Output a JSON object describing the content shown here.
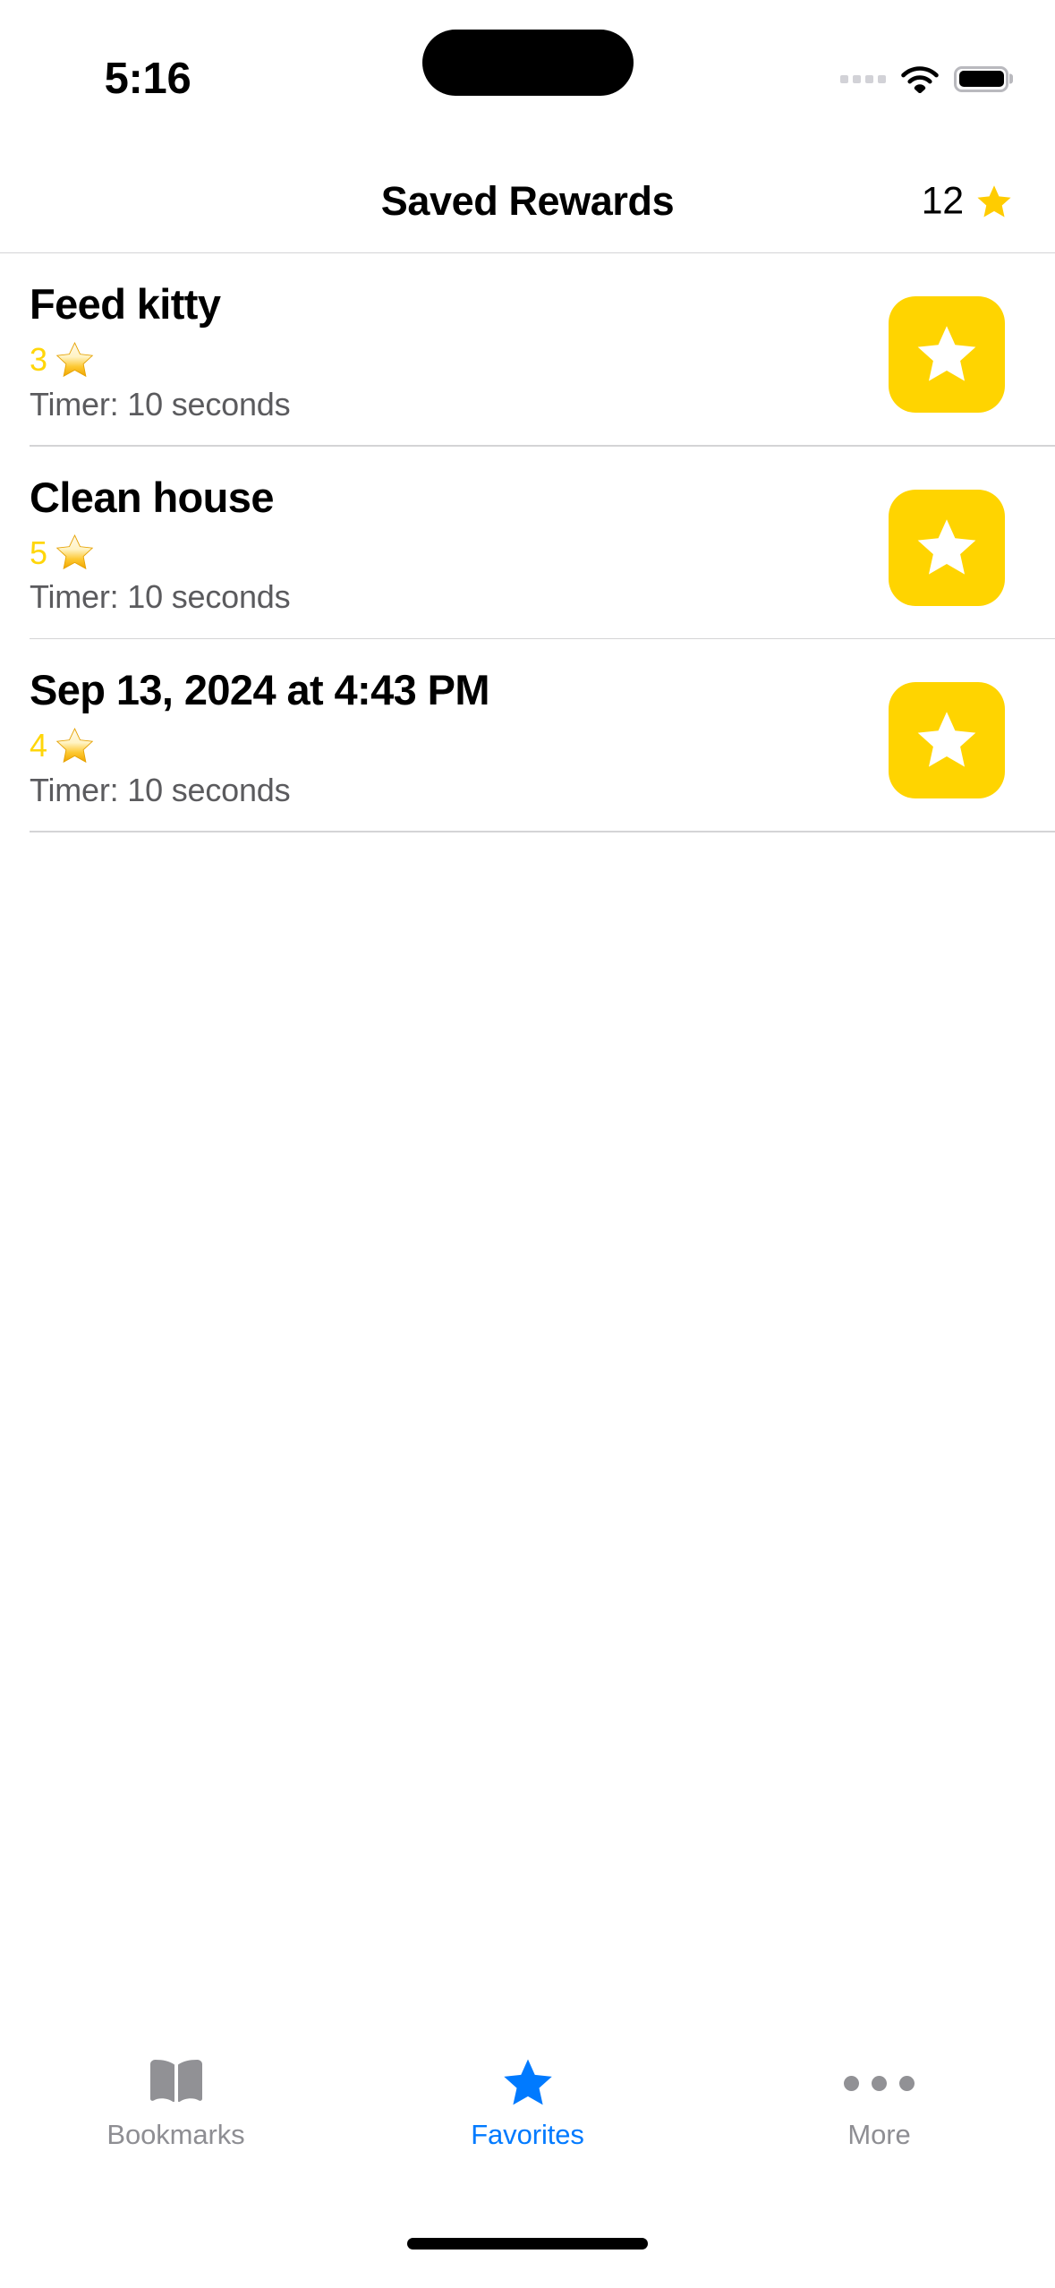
{
  "status_bar": {
    "time": "5:16",
    "cellular_icon": "cellular-dots-icon",
    "wifi_icon": "wifi-icon",
    "battery_icon": "battery-icon"
  },
  "header": {
    "title": "Saved Rewards",
    "points_value": "12",
    "points_star_icon": "star-filled-icon",
    "accent_gold": "#FFCC00"
  },
  "rewards": [
    {
      "title": "Feed kitty",
      "points": "3",
      "star_icon": "star-emoji-icon",
      "timer": "Timer: 10 seconds",
      "action_icon": "star-button-icon"
    },
    {
      "title": "Clean house",
      "points": "5",
      "star_icon": "star-emoji-icon",
      "timer": "Timer: 10 seconds",
      "action_icon": "star-button-icon"
    },
    {
      "title": "Sep 13, 2024 at 4:43 PM",
      "points": "4",
      "star_icon": "star-emoji-icon",
      "timer": "Timer: 10 seconds",
      "action_icon": "star-button-icon"
    }
  ],
  "tab_bar": {
    "active_color": "#007AFF",
    "inactive_color": "#8E8E93",
    "tabs": [
      {
        "label": "Bookmarks",
        "icon": "book-icon",
        "active": false
      },
      {
        "label": "Favorites",
        "icon": "star-icon",
        "active": true
      },
      {
        "label": "More",
        "icon": "ellipsis-icon",
        "active": false
      }
    ]
  },
  "colors": {
    "reward_points_yellow": "#FFD60A",
    "action_button_yellow": "#FFD400",
    "timer_gray": "#5B5B5E",
    "separator": "#D4D4D6"
  }
}
